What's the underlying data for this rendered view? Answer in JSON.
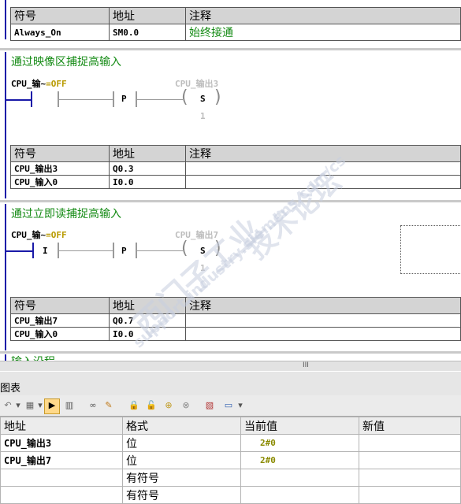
{
  "network1": {
    "headers": [
      "符号",
      "地址",
      "注释"
    ],
    "rows": [
      [
        "Always_On",
        "SM0.0",
        "始终接通"
      ]
    ]
  },
  "network2": {
    "title": "通过映像区捕捉高输入",
    "contact_label_prefix": "CPU_输~",
    "contact_label_state": "=OFF",
    "p_label": "P",
    "coil_label": "CPU_输出3",
    "coil_type": "S",
    "coil_count": "1",
    "symbols": {
      "headers": [
        "符号",
        "地址",
        "注释"
      ],
      "rows": [
        [
          "CPU_输出3",
          "Q0.3",
          ""
        ],
        [
          "CPU_输入0",
          "I0.0",
          ""
        ]
      ]
    }
  },
  "network3": {
    "title": "通过立即读捕捉高输入",
    "contact_label_prefix": "CPU_输~",
    "contact_label_state": "=OFF",
    "immediate_label": "I",
    "p_label": "P",
    "coil_label": "CPU_输出7",
    "coil_type": "S",
    "coil_count": "1",
    "symbols": {
      "headers": [
        "符号",
        "地址",
        "注释"
      ],
      "rows": [
        [
          "CPU_输出7",
          "Q0.7",
          ""
        ],
        [
          "CPU_输入0",
          "I0.0",
          ""
        ]
      ]
    }
  },
  "network4_partial_title": "输入沿程",
  "hscroll_grip": "III",
  "status_chart": {
    "title": "图表",
    "toolbar_icons": [
      "undo-icon",
      "dropdown-icon",
      "delete-icon",
      "dropdown-icon",
      "chart-run-icon",
      "stop-icon",
      "glasses-icon",
      "pencil-icon",
      "lock-icon",
      "unlock-icon",
      "force-icon",
      "unforce-icon",
      "trend-icon",
      "comment-icon",
      "dropdown-icon"
    ],
    "headers": [
      "地址",
      "格式",
      "当前值",
      "新值"
    ],
    "rows": [
      {
        "address": "CPU_输出3",
        "format": "位",
        "current": "2#0",
        "new": ""
      },
      {
        "address": "CPU_输出7",
        "format": "位",
        "current": "2#0",
        "new": ""
      },
      {
        "address": "",
        "format": "有符号",
        "current": "",
        "new": ""
      },
      {
        "address": "",
        "format": "有符号",
        "current": "",
        "new": ""
      }
    ]
  },
  "watermark": {
    "line1": "西门子工业",
    "line2": "技术论坛",
    "line3": "support.industry.siemens.com/cs"
  },
  "colors": {
    "rail": "#1a1aa8",
    "title": "#138a13",
    "off_state": "#b89a00",
    "value": "#8a8a00",
    "inactive": "#a8a8a8"
  }
}
